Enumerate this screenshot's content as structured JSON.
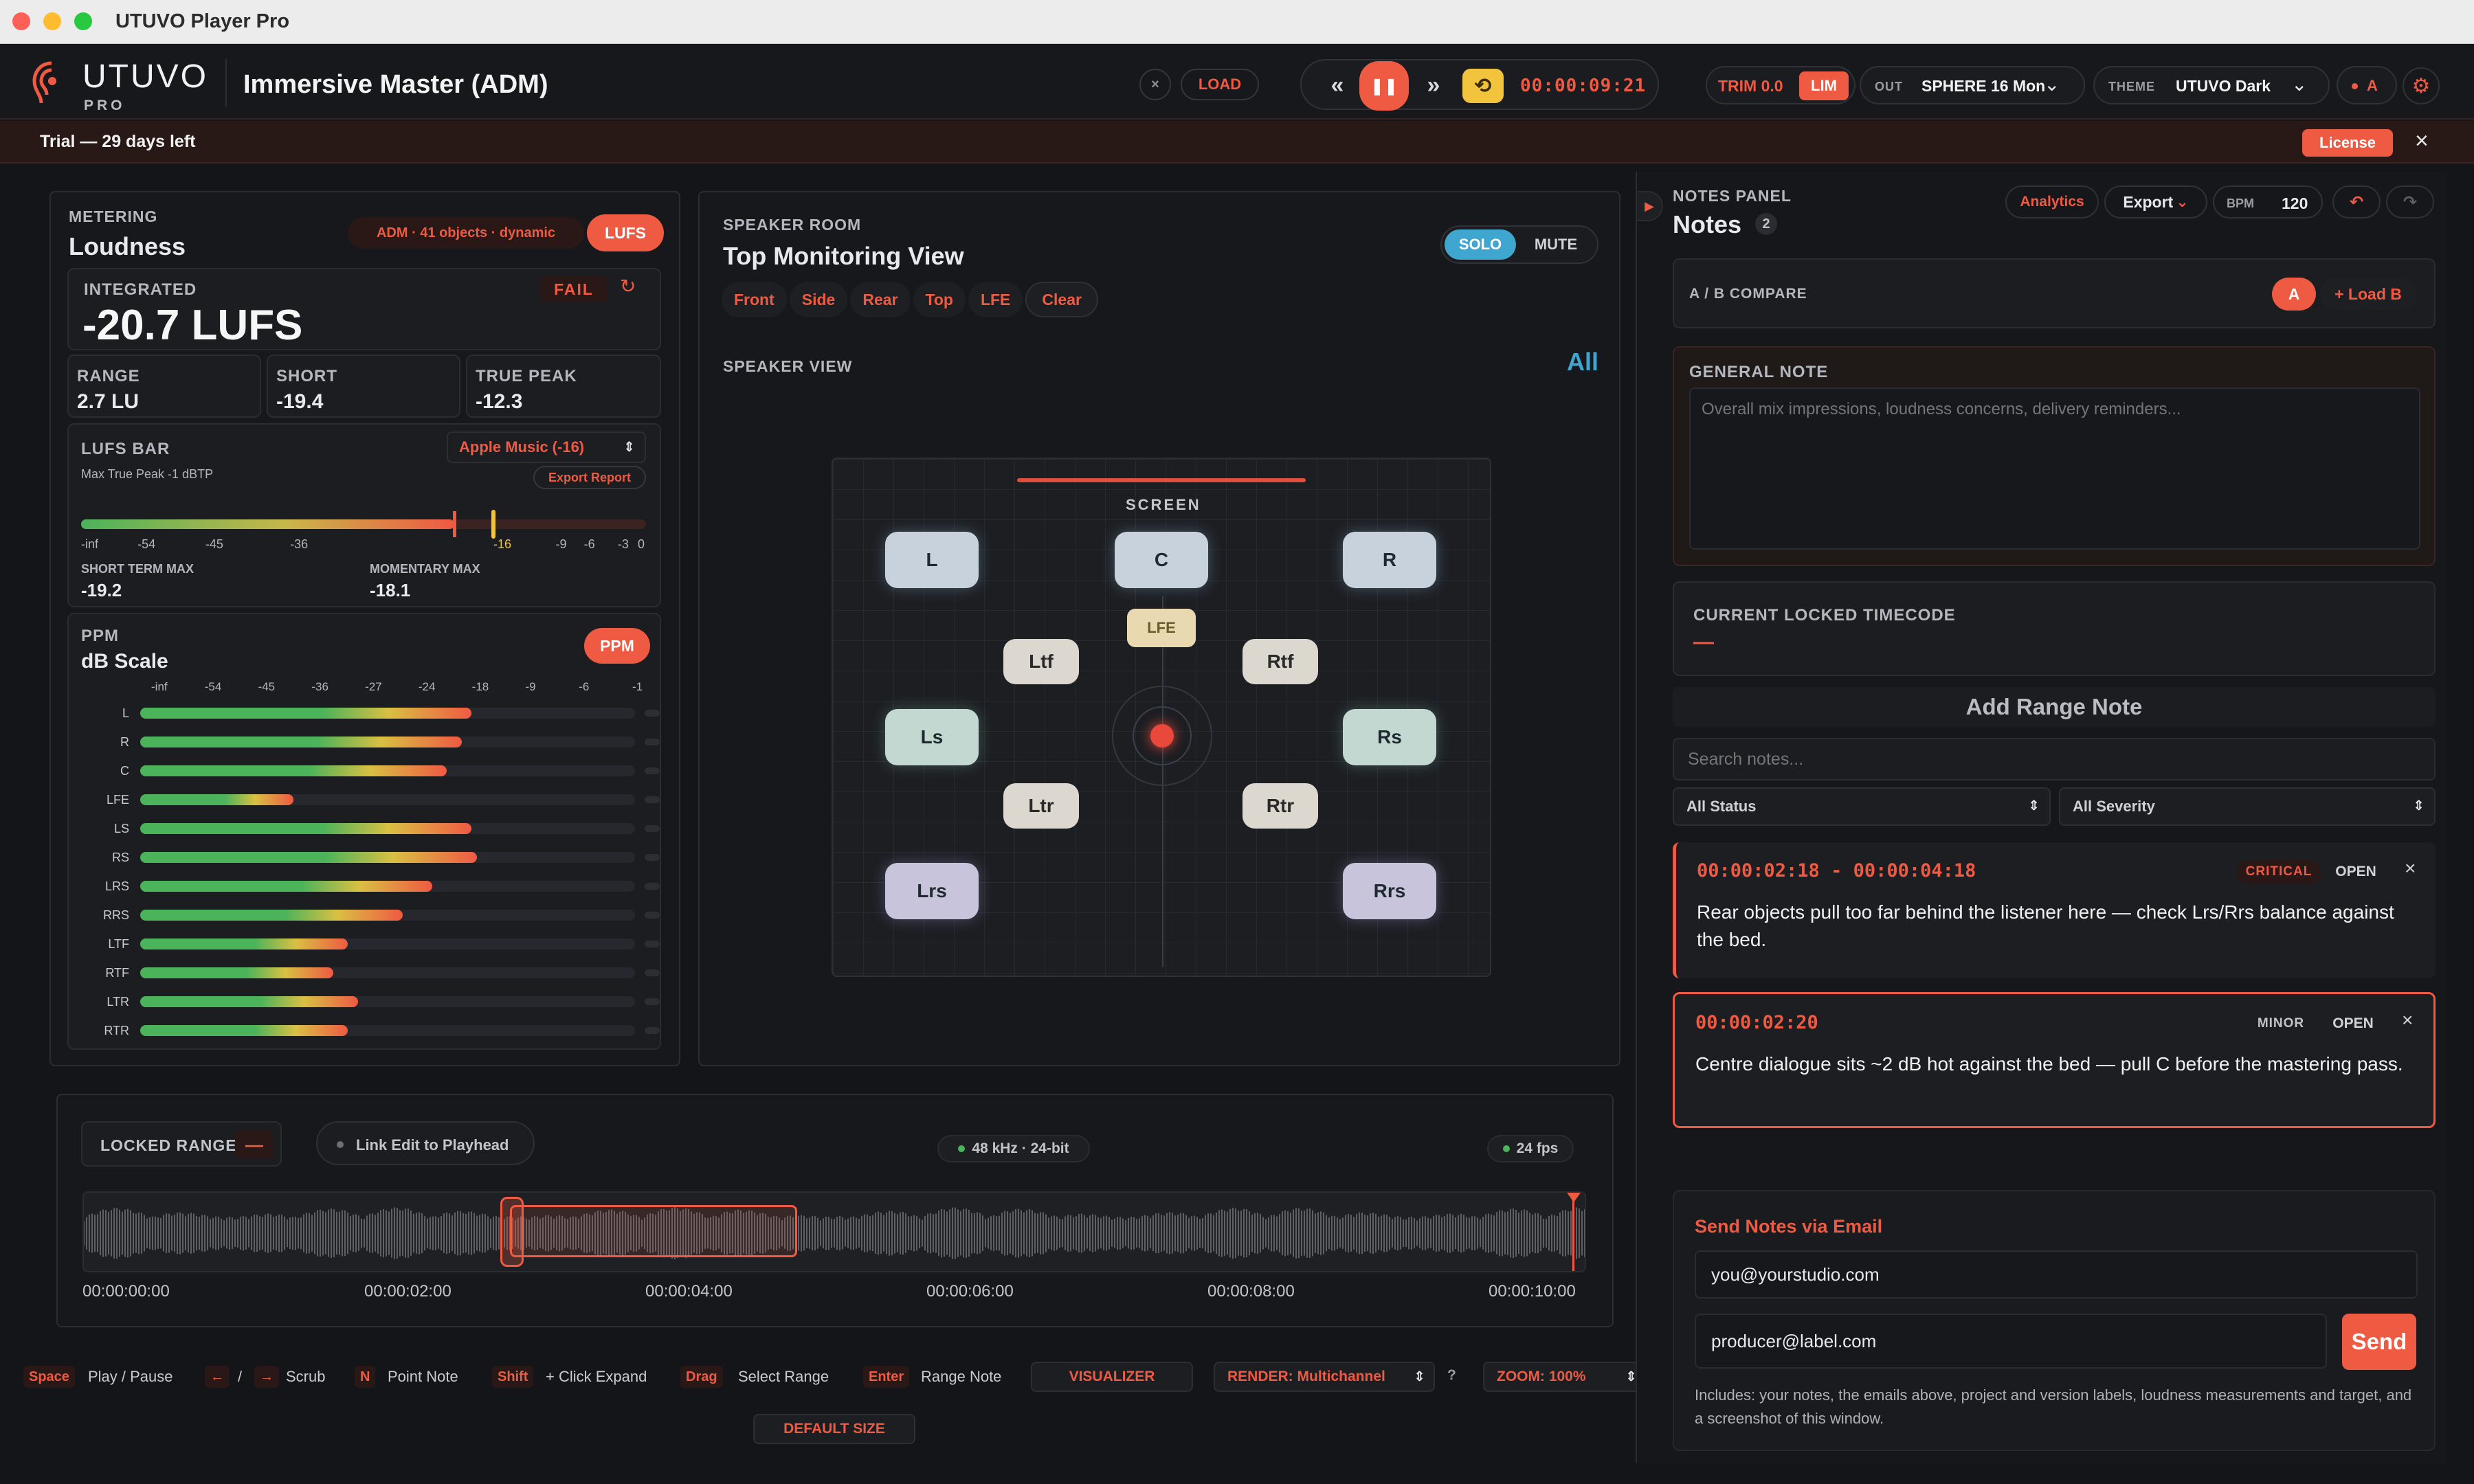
{
  "window": {
    "title": "UTUVO Player Pro"
  },
  "brand": {
    "name": "UTUVO",
    "sub": "PRO"
  },
  "project": {
    "title": "Immersive Master (ADM)"
  },
  "header": {
    "load": "LOAD",
    "timecode": "00:00:09:21",
    "trim": "TRIM 0.0",
    "lim": "LIM",
    "out_label": "OUT",
    "out_value": "SPHERE 16 Mon",
    "theme_label": "THEME",
    "theme_value": "UTUVO Dark",
    "ab_badge": "A"
  },
  "trial": {
    "text": "Trial — 29 days left",
    "license": "License"
  },
  "metering": {
    "section": "METERING",
    "title": "Loudness",
    "adm_badge": "ADM · 41 objects · dynamic",
    "lufs_btn": "LUFS",
    "integrated_label": "INTEGRATED",
    "fail": "FAIL",
    "integrated_value": "-20.7 LUFS",
    "stats": [
      {
        "label": "RANGE",
        "value": "2.7 LU"
      },
      {
        "label": "SHORT",
        "value": "-19.4"
      },
      {
        "label": "TRUE PEAK",
        "value": "-12.3"
      }
    ],
    "lufs_bar": {
      "label": "LUFS BAR",
      "sub": "Max True Peak -1 dBTP",
      "preset": "Apple Music (-16)",
      "export": "Export Report",
      "ticks": [
        "-inf",
        "-54",
        "-45",
        "-36",
        "-16",
        "-9",
        "-6",
        "-3",
        "0"
      ],
      "fill_fraction": 0.66,
      "target_fraction": 0.73
    },
    "short_term_max": {
      "label": "SHORT TERM MAX",
      "value": "-19.2"
    },
    "momentary_max": {
      "label": "MOMENTARY MAX",
      "value": "-18.1"
    }
  },
  "ppm": {
    "section": "PPM",
    "title": "dB Scale",
    "btn": "PPM",
    "scale": [
      "-inf",
      "-54",
      "-45",
      "-36",
      "-27",
      "-24",
      "-18",
      "-9",
      "-6",
      "-1"
    ],
    "channels": [
      {
        "name": "L",
        "level": 0.67
      },
      {
        "name": "R",
        "level": 0.65
      },
      {
        "name": "C",
        "level": 0.62
      },
      {
        "name": "LFE",
        "level": 0.31
      },
      {
        "name": "LS",
        "level": 0.67
      },
      {
        "name": "RS",
        "level": 0.68
      },
      {
        "name": "LRS",
        "level": 0.59
      },
      {
        "name": "RRS",
        "level": 0.53
      },
      {
        "name": "LTF",
        "level": 0.42
      },
      {
        "name": "RTF",
        "level": 0.39
      },
      {
        "name": "LTR",
        "level": 0.44
      },
      {
        "name": "RTR",
        "level": 0.42
      }
    ]
  },
  "speaker_room": {
    "section": "SPEAKER ROOM",
    "title": "Top Monitoring View",
    "solo": "SOLO",
    "mute": "MUTE",
    "filters": [
      "Front",
      "Side",
      "Rear",
      "Top",
      "LFE",
      "Clear"
    ],
    "view_label": "SPEAKER VIEW",
    "view_all": "All",
    "screen": "SCREEN",
    "speakers": {
      "L": "L",
      "C": "C",
      "R": "R",
      "LFE": "LFE",
      "Ltf": "Ltf",
      "Rtf": "Rtf",
      "Ls": "Ls",
      "Rs": "Rs",
      "Ltr": "Ltr",
      "Rtr": "Rtr",
      "Lrs": "Lrs",
      "Rrs": "Rrs"
    }
  },
  "timeline": {
    "locked_range": "LOCKED RANGE",
    "link_edit": "Link Edit to Playhead",
    "format": "48 kHz · 24-bit",
    "fps": "24 fps",
    "times": [
      "00:00:00:00",
      "00:00:02:00",
      "00:00:04:00",
      "00:00:06:00",
      "00:00:08:00",
      "00:00:10:00"
    ]
  },
  "shortcuts": [
    {
      "key": "Space",
      "action": "Play / Pause"
    },
    {
      "key": "←",
      "action": "/"
    },
    {
      "key": "→",
      "action": "Scrub"
    },
    {
      "key": "N",
      "action": "Point Note"
    },
    {
      "key": "Shift",
      "action": "+ Click Expand"
    },
    {
      "key": "Drag",
      "action": "Select Range"
    },
    {
      "key": "Enter",
      "action": "Range Note"
    }
  ],
  "footer": {
    "visualizer": "VISUALIZER",
    "render": "RENDER: Multichannel",
    "help": "?",
    "zoom": "ZOOM: 100%",
    "default_size": "DEFAULT SIZE"
  },
  "notes": {
    "section": "NOTES PANEL",
    "title": "Notes",
    "count": "2",
    "analytics": "Analytics",
    "export": "Export",
    "bpm_label": "BPM",
    "bpm_value": "120",
    "ab_compare": "A / B COMPARE",
    "ab_a": "A",
    "load_b": "+ Load B",
    "general_label": "GENERAL NOTE",
    "general_placeholder": "Overall mix impressions, loudness concerns, delivery reminders...",
    "locked_label": "CURRENT LOCKED TIMECODE",
    "locked_value": "—",
    "add_range": "Add Range Note",
    "search_placeholder": "Search notes...",
    "status_filter": "All Status",
    "severity_filter": "All Severity",
    "items": [
      {
        "time": "00:00:02:18 - 00:00:04:18",
        "severity": "CRITICAL",
        "status": "OPEN",
        "text": "Rear objects pull too far behind the listener here — check Lrs/Rrs balance against the bed."
      },
      {
        "time": "00:00:02:20",
        "severity": "MINOR",
        "status": "OPEN",
        "text": "Centre dialogue sits ~2 dB hot against the bed — pull C before the mastering pass."
      }
    ],
    "email": {
      "title": "Send Notes via Email",
      "from": "you@yourstudio.com",
      "to": "producer@label.com",
      "send": "Send",
      "footer": "Includes: your notes, the emails above, project and version labels, loudness measurements and target, and a screenshot of this window."
    }
  },
  "colors": {
    "accent": "#ef5a43",
    "solo": "#3fa6d0",
    "yellow": "#f2c33c",
    "bg": "#141518"
  }
}
